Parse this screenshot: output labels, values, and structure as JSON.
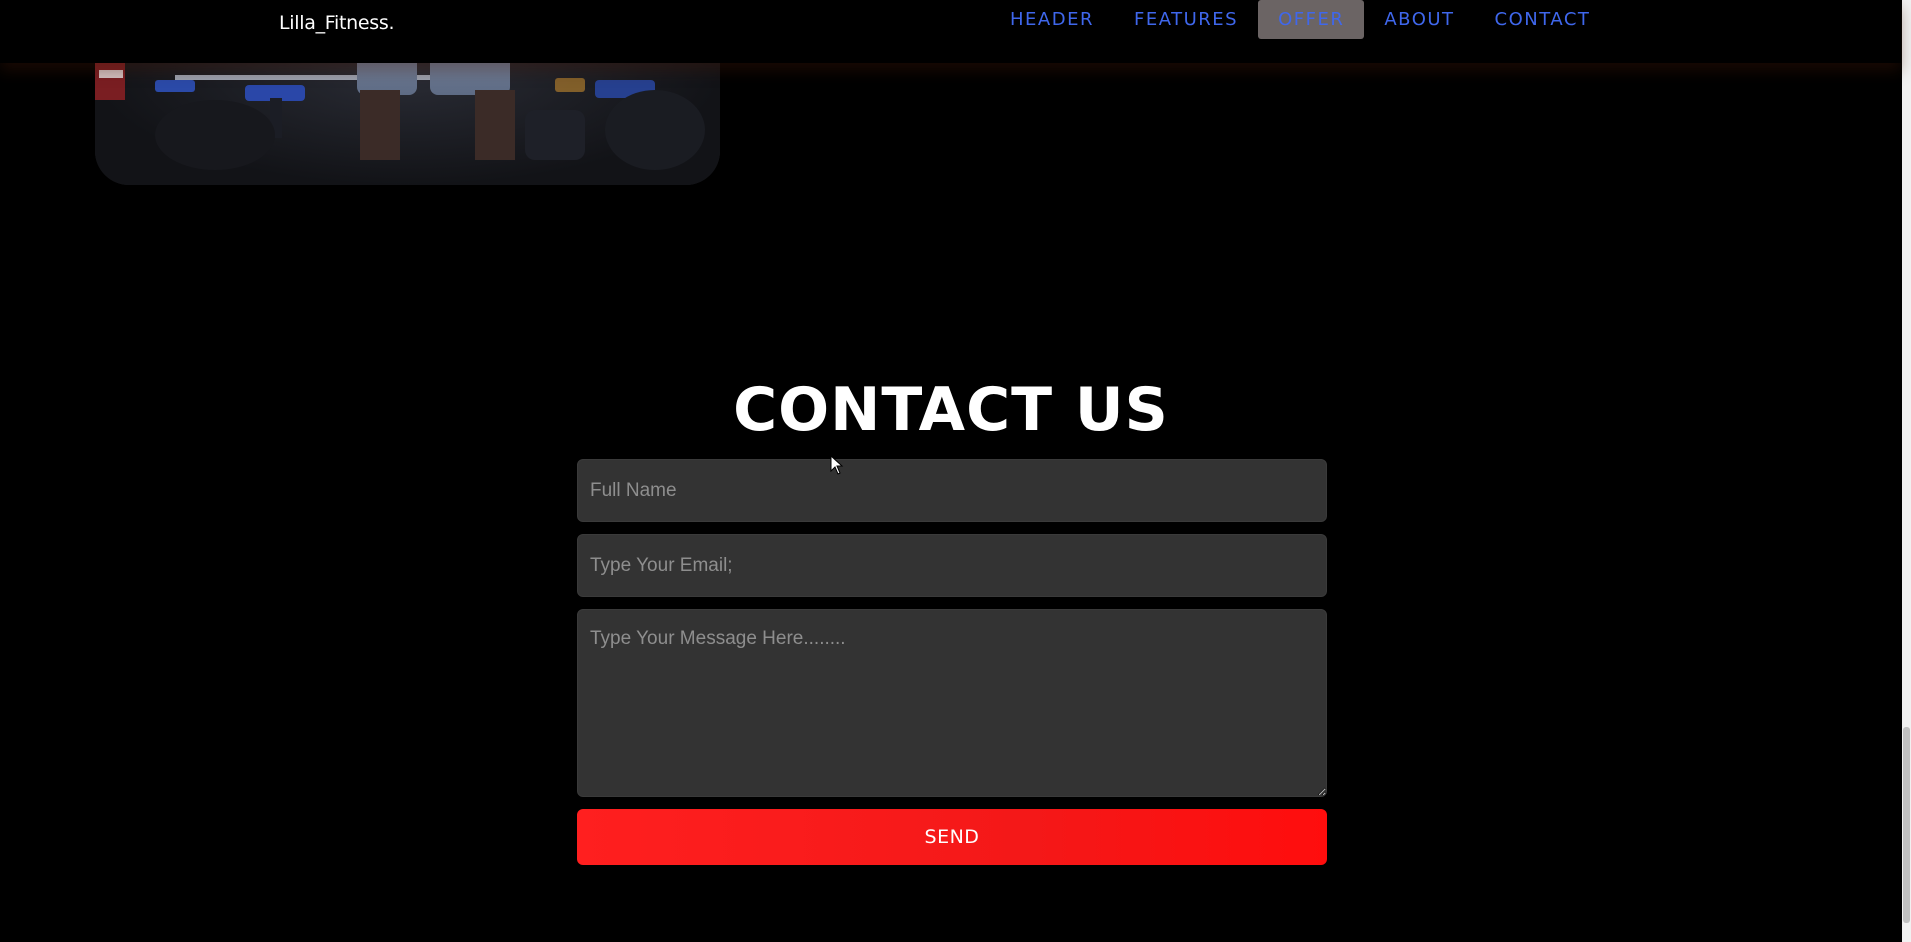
{
  "navbar": {
    "brand": "Lilla_Fitness.",
    "links": [
      {
        "label": "HEADER"
      },
      {
        "label": "FEATURES"
      },
      {
        "label": "OFFER",
        "active": true
      },
      {
        "label": "ABOUT"
      },
      {
        "label": "CONTACT"
      }
    ],
    "link_color": "#3f67ec",
    "active_bg": "#6b6464"
  },
  "contact": {
    "title": "CONTACT US",
    "name_placeholder": "Full Name",
    "email_placeholder": "Type Your Email;",
    "message_placeholder": "Type Your Message Here........",
    "send_label": "SEND",
    "send_color": "#ff1414"
  },
  "image": {
    "icon": "gym-photo"
  }
}
